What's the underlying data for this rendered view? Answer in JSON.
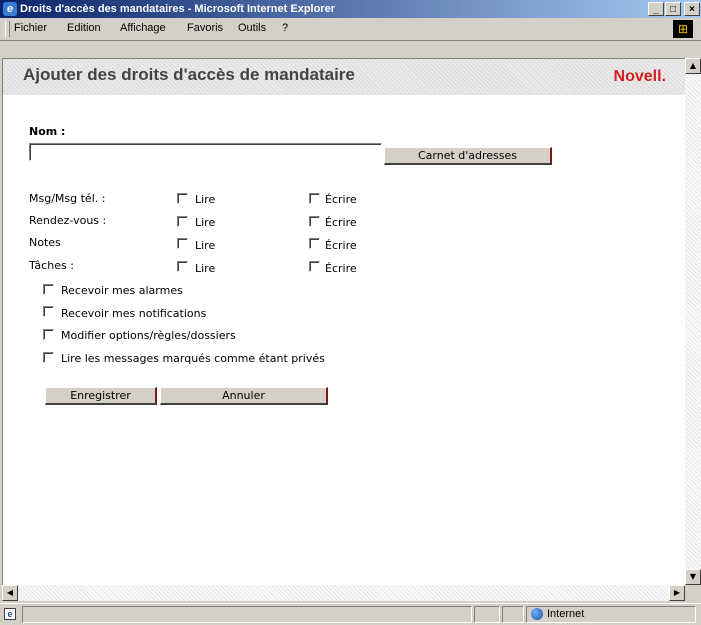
{
  "window": {
    "title": "Droits d'accès des mandataires - Microsoft Internet Explorer",
    "controls": {
      "minimize": "_",
      "maximize": "□",
      "close": "×"
    }
  },
  "menu": {
    "items": [
      "Fichier",
      "Edition",
      "Affichage",
      "Favoris",
      "Outils",
      "?"
    ]
  },
  "page": {
    "heading": "Ajouter des droits d'accès de mandataire",
    "logo": "Novell."
  },
  "form": {
    "name_label": "Nom :",
    "name_value": "",
    "address_book_button": "Carnet d'adresses",
    "rights": [
      {
        "label": "Msg/Msg tél. :",
        "read": "Lire",
        "write": "Écrire",
        "read_checked": false,
        "write_checked": false
      },
      {
        "label": "Rendez-vous :",
        "read": "Lire",
        "write": "Écrire",
        "read_checked": false,
        "write_checked": false
      },
      {
        "label": "Notes",
        "read": "Lire",
        "write": "Écrire",
        "read_checked": false,
        "write_checked": false
      },
      {
        "label": "Tâches :",
        "read": "Lire",
        "write": "Écrire",
        "read_checked": false,
        "write_checked": false
      }
    ],
    "options": [
      {
        "label": "Recevoir mes alarmes",
        "checked": false
      },
      {
        "label": "Recevoir mes notifications",
        "checked": false
      },
      {
        "label": "Modifier options/règles/dossiers",
        "checked": false
      },
      {
        "label": "Lire les messages marqués comme étant privés",
        "checked": false
      }
    ],
    "save_button": "Enregistrer",
    "cancel_button": "Annuler"
  },
  "status": {
    "zone": "Internet"
  },
  "colors": {
    "title_bar": "#0a246a",
    "logo": "#d21f1f",
    "heading": "#444444",
    "chrome": "#d4d0c8"
  }
}
